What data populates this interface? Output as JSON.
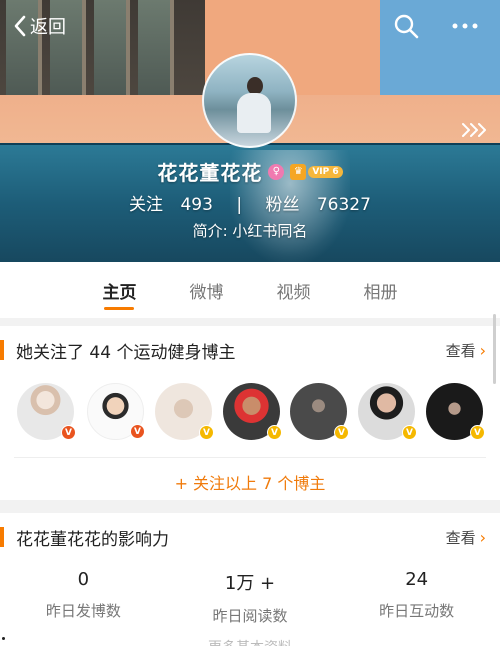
{
  "header": {
    "back_label": "返回",
    "name": "花花董花花",
    "vip_label": "VIP 6",
    "stats": {
      "following_label": "关注",
      "following_count": "493",
      "separator": "|",
      "fans_label": "粉丝",
      "fans_count": "76327"
    },
    "intro": "简介: 小红书同名"
  },
  "tabs": [
    {
      "label": "主页",
      "active": true
    },
    {
      "label": "微博",
      "active": false
    },
    {
      "label": "视频",
      "active": false
    },
    {
      "label": "相册",
      "active": false
    }
  ],
  "follow_card": {
    "title": "她关注了 44 个运动健身博主",
    "view_label": "查看",
    "follow_all_label": "+ 关注以上 7 个博主",
    "bloggers": [
      {
        "badge": "orange"
      },
      {
        "badge": "orange"
      },
      {
        "badge": "yellow"
      },
      {
        "badge": "yellow"
      },
      {
        "badge": "yellow"
      },
      {
        "badge": "yellow"
      },
      {
        "badge": "yellow"
      }
    ]
  },
  "influence_card": {
    "title": "花花董花花的影响力",
    "view_label": "查看",
    "metrics": [
      {
        "value": "0",
        "label": "昨日发博数"
      },
      {
        "value": "1万 +",
        "label": "昨日阅读数"
      },
      {
        "value": "24",
        "label": "昨日互动数"
      }
    ],
    "more_text": "更多基本资料"
  },
  "colors": {
    "accent": "#f77b00",
    "badge_orange": "#e9541f",
    "badge_yellow": "#f5b800"
  }
}
